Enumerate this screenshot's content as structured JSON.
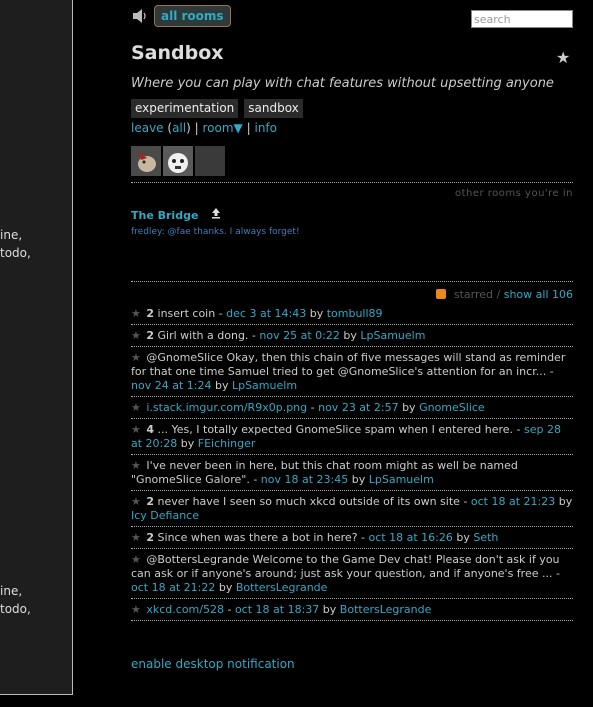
{
  "left_fragments": [
    "ine,",
    "todo,",
    "ine,",
    "todo,"
  ],
  "header": {
    "all_rooms_label": "all rooms",
    "search_placeholder": "search"
  },
  "room": {
    "title": "Sandbox",
    "description": "Where you can play with chat features without upsetting anyone",
    "tags": [
      "experimentation",
      "sandbox"
    ],
    "links": {
      "leave": "leave",
      "all": "all",
      "room": "room▼",
      "info": "info"
    }
  },
  "other_rooms": {
    "label": "other rooms you're in",
    "rooms": [
      {
        "name": "The Bridge",
        "last_message": "fredley: @fae thanks. I always forget!"
      }
    ]
  },
  "starred": {
    "label": "starred /",
    "show_all": "show all 106",
    "items": [
      {
        "count": "2",
        "text": "insert coin - ",
        "time": "dec 3 at 14:43",
        "by": " by ",
        "user": "tombull89"
      },
      {
        "count": "2",
        "text": "Girl with a dong. - ",
        "time": "nov 25 at 0:22",
        "by": " by ",
        "user": "LpSamuelm"
      },
      {
        "count": "",
        "text": "@GnomeSlice Okay, then this chain of five messages will stand as reminder for that one time Samuel tried to get @GnomeSlice's attention for an incr... - ",
        "time": "nov 24 at 1:24",
        "by": " by ",
        "user": "LpSamuelm"
      },
      {
        "count": "",
        "link": "i.stack.imgur.com/R9x0p.png",
        "text": " - ",
        "time": "nov 23 at 2:57",
        "by": " by ",
        "user": "GnomeSlice"
      },
      {
        "count": "4",
        "text": "... Yes, I totally expected GnomeSlice spam when I entered here. - ",
        "time": "sep 28 at 20:28",
        "by": " by ",
        "user": "FEichinger"
      },
      {
        "count": "",
        "text": "I've never been in here, but this chat room might as well be named \"GnomeSlice Galore\". - ",
        "time": "nov 18 at 23:45",
        "by": " by ",
        "user": "LpSamuelm"
      },
      {
        "count": "2",
        "text": "never have I seen so much xkcd outside of its own site - ",
        "time": "oct 18 at 21:23",
        "by": " by ",
        "user": "Icy Defiance"
      },
      {
        "count": "2",
        "text": "Since when was there a bot in here? - ",
        "time": "oct 18 at 16:26",
        "by": " by ",
        "user": "Seth"
      },
      {
        "count": "",
        "text": "@BottersLegrande Welcome to the Game Dev chat! Please don't ask if you can ask or if anyone's around; just ask your question, and if anyone's free ... - ",
        "time": "oct 18 at 21:22",
        "by": " by ",
        "user": "BottersLegrande"
      },
      {
        "count": "",
        "link": "xkcd.com/528",
        "text": " - ",
        "time": "oct 18 at 18:37",
        "by": " by ",
        "user": "BottersLegrande"
      }
    ]
  },
  "footer": {
    "desktop_notification": "enable desktop notification"
  },
  "colors": {
    "link": "#33a9c4",
    "background": "#000000",
    "text": "#cccccc"
  }
}
